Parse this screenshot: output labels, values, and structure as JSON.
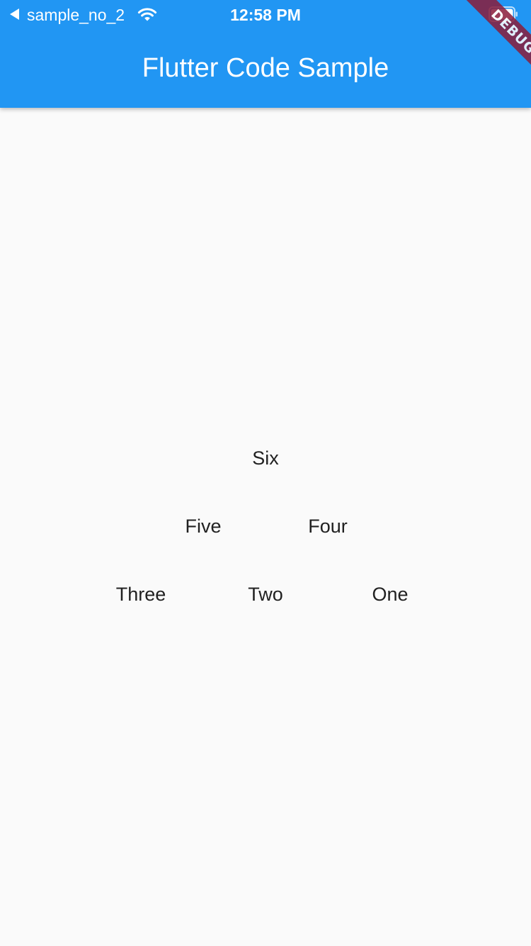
{
  "status_bar": {
    "back_label": "sample_no_2",
    "time": "12:58 PM"
  },
  "app_bar": {
    "title": "Flutter Code Sample"
  },
  "debug_banner": {
    "label": "DEBUG"
  },
  "items": [
    {
      "label": "Six"
    },
    {
      "label": "Five"
    },
    {
      "label": "Four"
    },
    {
      "label": "Three"
    },
    {
      "label": "Two"
    },
    {
      "label": "One"
    }
  ],
  "colors": {
    "app_bar": "#2196f3",
    "background": "#fafafa",
    "text": "#212121",
    "debug_banner": "#8a1c3a"
  },
  "icons": [
    "back-arrow-icon",
    "wifi-icon",
    "battery-icon"
  ]
}
